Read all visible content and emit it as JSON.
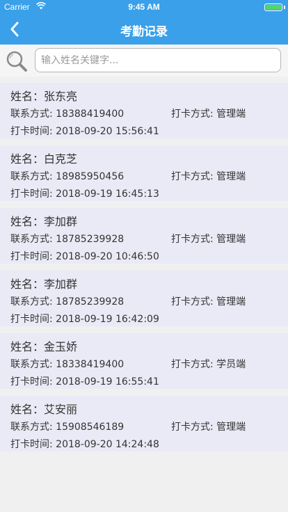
{
  "status_bar": {
    "carrier": "Carrier",
    "time": "9:45 AM",
    "battery_color": "#4cd964"
  },
  "nav": {
    "title": "考勤记录",
    "back_icon": "chevron-left-icon",
    "background": "#3aa0ea"
  },
  "search": {
    "icon": "search-icon",
    "placeholder": "输入姓名关键字..."
  },
  "labels": {
    "name": "姓名：",
    "phone": "联系方式: ",
    "method": "打卡方式: ",
    "time": "打卡时间: "
  },
  "records": [
    {
      "name": "张东亮",
      "phone": "18388419400",
      "method": "管理端",
      "time": "2018-09-20 15:56:41"
    },
    {
      "name": "白克芝",
      "phone": "18985950456",
      "method": "管理端",
      "time": "2018-09-19 16:45:13"
    },
    {
      "name": "李加群",
      "phone": "18785239928",
      "method": "管理端",
      "time": "2018-09-20 10:46:50"
    },
    {
      "name": "李加群",
      "phone": "18785239928",
      "method": "管理端",
      "time": "2018-09-19 16:42:09"
    },
    {
      "name": "金玉娇",
      "phone": "18338419400",
      "method": "学员端",
      "time": "2018-09-19 16:55:41"
    },
    {
      "name": "艾安丽",
      "phone": "15908546189",
      "method": "管理端",
      "time": "2018-09-20 14:24:48"
    }
  ]
}
